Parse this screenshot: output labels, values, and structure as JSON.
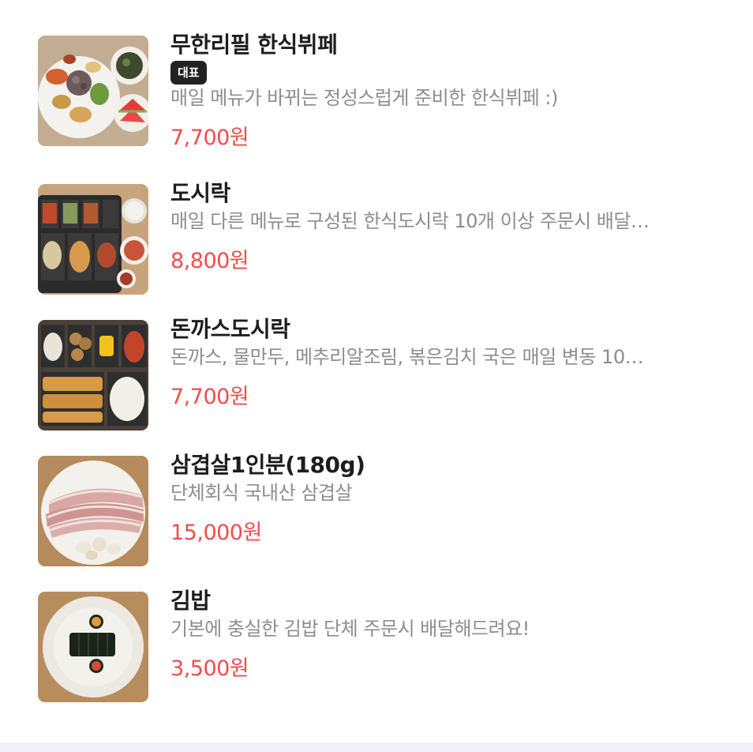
{
  "menu": {
    "items": [
      {
        "name": "무한리필 한식뷔페",
        "badge": "대표",
        "description": "매일 메뉴가 바뀌는 정성스럽게 준비한 한식뷔페 :)",
        "price": "7,700원",
        "image": "korean-buffet-plate-photo"
      },
      {
        "name": "도시락",
        "badge": "",
        "description": "매일 다른 메뉴로 구성된 한식도시락 10개 이상 주문시 배달…",
        "price": "8,800원",
        "image": "korean-lunchbox-photo"
      },
      {
        "name": "돈까스도시락",
        "badge": "",
        "description": "돈까스, 물만두, 메추리알조림, 볶은김치 국은 매일 변동 10…",
        "price": "7,700원",
        "image": "pork-cutlet-lunchbox-photo"
      },
      {
        "name": "삼겹살1인분(180g)",
        "badge": "",
        "description": "단체회식 국내산 삼겹살",
        "price": "15,000원",
        "image": "pork-belly-plate-photo"
      },
      {
        "name": "김밥",
        "badge": "",
        "description": "기본에 충실한 김밥 단체 주문시 배달해드려요!",
        "price": "3,500원",
        "image": "gimbap-plate-photo"
      }
    ]
  },
  "colors": {
    "price": "#f24c4c",
    "name": "#1d1d1d",
    "description": "#8d8d8d",
    "badge_bg": "#222222"
  }
}
